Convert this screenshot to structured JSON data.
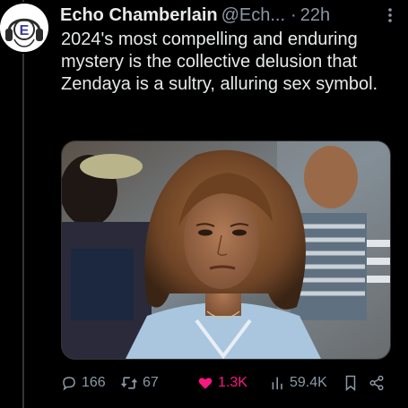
{
  "tweet": {
    "avatar_letter": "E",
    "author_name": "Echo Chamberlain",
    "handle": "@Ech...",
    "separator": "·",
    "time": "22h",
    "text": "2024's most compelling and enduring mystery is the collective delusion that Zendaya is a sultry, alluring sex symbol."
  },
  "metrics": {
    "replies": "166",
    "retweets": "67",
    "likes": "1.3K",
    "views": "59.4K"
  },
  "icons": {
    "more": "more-dots-icon",
    "reply": "reply-icon",
    "retweet": "retweet-icon",
    "like": "heart-icon",
    "views": "views-chart-icon",
    "bookmark": "bookmark-icon",
    "share": "share-icon"
  },
  "colors": {
    "background": "#000000",
    "text": "#e7e9ea",
    "secondary": "#8b98a5",
    "like_active": "#f91880"
  }
}
